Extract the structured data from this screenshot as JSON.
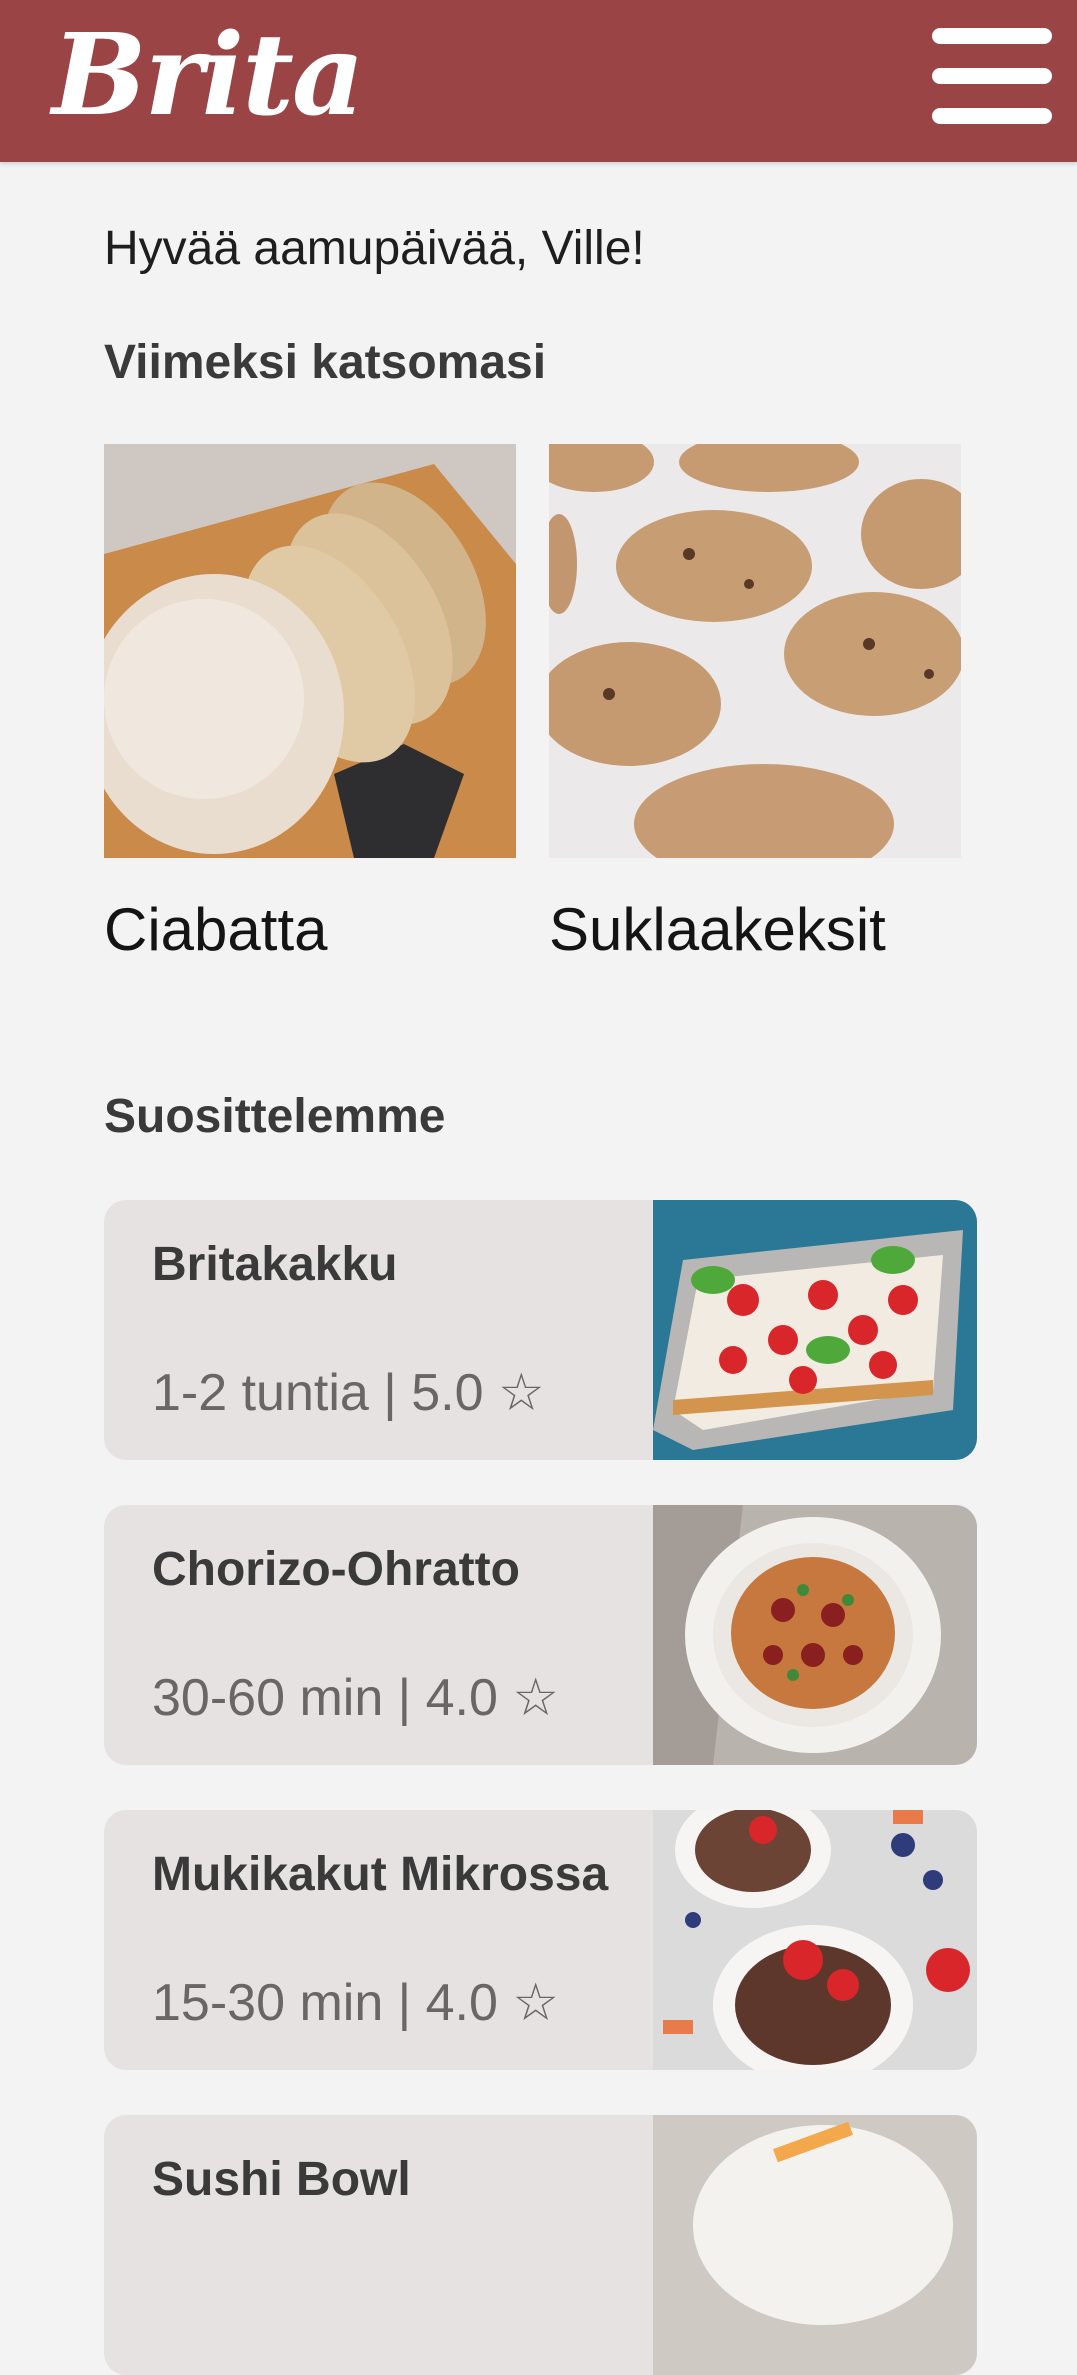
{
  "header": {
    "logo_text": "Brita",
    "menu_icon": "hamburger-menu-icon",
    "bg_color": "#9a4446"
  },
  "greeting": "Hyvää aamupäivää, Ville!",
  "recent": {
    "title": "Viimeksi katsomasi",
    "items": [
      {
        "name": "Ciabatta"
      },
      {
        "name": "Suklaakeksit"
      }
    ]
  },
  "recommended": {
    "title": "Suosittelemme",
    "items": [
      {
        "title": "Britakakku",
        "meta": "1-2 tuntia | 5.0 ☆"
      },
      {
        "title": "Chorizo-Ohratto",
        "meta": "30-60 min | 4.0 ☆"
      },
      {
        "title": "Mukikakut Mikrossa",
        "meta": "15-30 min | 4.0 ☆"
      },
      {
        "title": "Sushi Bowl"
      }
    ]
  }
}
